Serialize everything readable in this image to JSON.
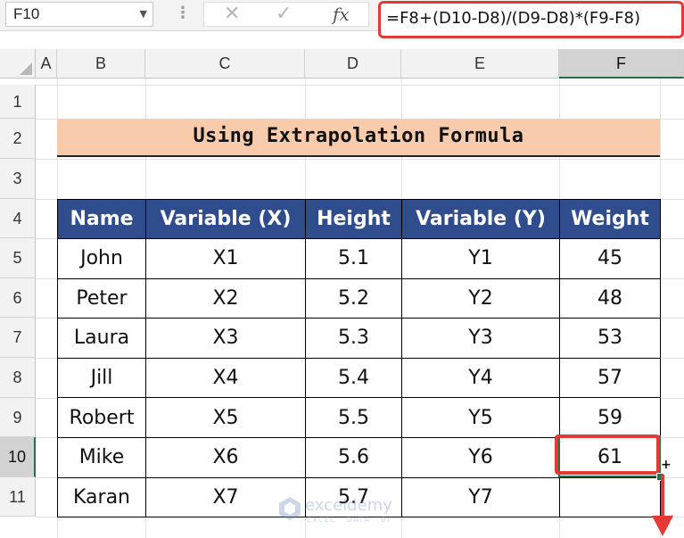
{
  "formula_bar": {
    "name_box": "F10",
    "cancel_icon": "✕",
    "enter_icon": "✓",
    "fx_label": "fx",
    "formula": "=F8+(D10-D8)/(D9-D8)*(F9-F8)"
  },
  "columns": [
    "A",
    "B",
    "C",
    "D",
    "E",
    "F"
  ],
  "rows": [
    "1",
    "2",
    "3",
    "4",
    "5",
    "6",
    "7",
    "8",
    "9",
    "10",
    "11"
  ],
  "selected_cell": "F10",
  "title": "Using Extrapolation Formula",
  "table": {
    "headers": [
      "Name",
      "Variable (X)",
      "Height",
      "Variable (Y)",
      "Weight"
    ],
    "rows": [
      [
        "John",
        "X1",
        "5.1",
        "Y1",
        "45"
      ],
      [
        "Peter",
        "X2",
        "5.2",
        "Y2",
        "48"
      ],
      [
        "Laura",
        "X3",
        "5.3",
        "Y3",
        "53"
      ],
      [
        "Jill",
        "X4",
        "5.4",
        "Y4",
        "57"
      ],
      [
        "Robert",
        "X5",
        "5.5",
        "Y5",
        "59"
      ],
      [
        "Mike",
        "X6",
        "5.6",
        "Y6",
        "61"
      ],
      [
        "Karan",
        "X7",
        "5.7",
        "Y7",
        ""
      ]
    ]
  },
  "watermark": {
    "name": "exceldemy",
    "tagline": "EXCEL · DATA · BI"
  },
  "colors": {
    "header_fill": "#2f4c8c",
    "title_fill": "#f8cbad",
    "highlight": "#e53935",
    "selection": "#217346"
  }
}
